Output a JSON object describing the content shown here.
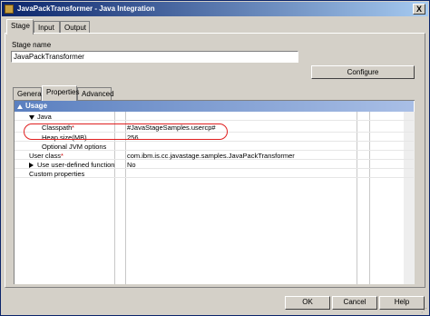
{
  "window": {
    "title": "JavaPackTransformer - Java Integration",
    "close_label": "X"
  },
  "top_tabs": [
    {
      "label": "Stage"
    },
    {
      "label": "Input"
    },
    {
      "label": "Output"
    }
  ],
  "stage_name": {
    "label": "Stage name",
    "value": "JavaPackTransformer"
  },
  "configure_label": "Configure",
  "sub_tabs": [
    {
      "label": "General"
    },
    {
      "label": "Properties"
    },
    {
      "label": "Advanced"
    }
  ],
  "properties": {
    "group_label": "Usage",
    "rows": [
      {
        "name": "Java",
        "value": ""
      },
      {
        "name": "Classpath",
        "required_mark": "*",
        "value": "#JavaStageSamples.usercp#"
      },
      {
        "name": "Heap size(MB)",
        "value": "256"
      },
      {
        "name": "Optional JVM options",
        "value": ""
      },
      {
        "name": "User class",
        "required_mark": "*",
        "value": "com.ibm.is.cc.javastage.samples.JavaPackTransformer"
      },
      {
        "name": "Use user-defined function",
        "value": "No"
      },
      {
        "name": "Custom properties",
        "value": ""
      }
    ]
  },
  "buttons": {
    "ok": "OK",
    "cancel": "Cancel",
    "help": "Help"
  },
  "colors": {
    "title_start": "#0a246a",
    "group_header": "#5a7fbf",
    "highlight": "#e02020"
  }
}
